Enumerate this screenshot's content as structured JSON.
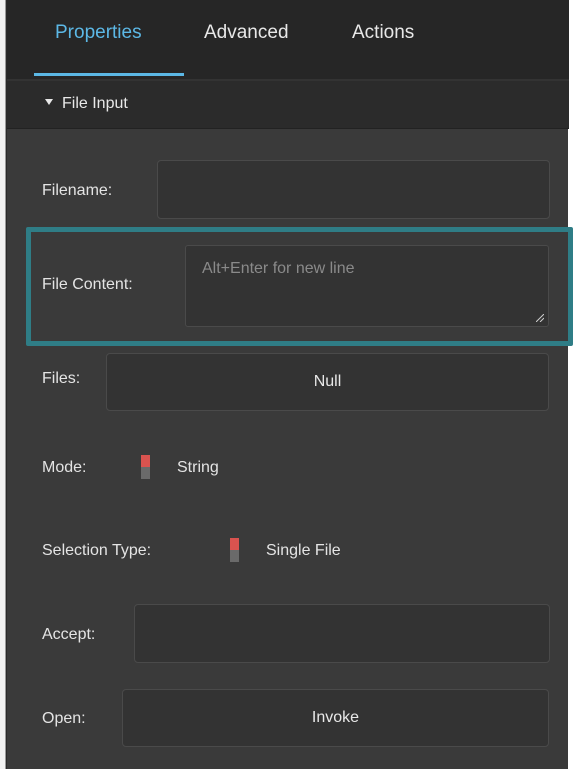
{
  "tabs": [
    {
      "label": "Properties",
      "active": true
    },
    {
      "label": "Advanced",
      "active": false
    },
    {
      "label": "Actions",
      "active": false
    }
  ],
  "section": {
    "title": "File Input",
    "expanded": true
  },
  "fields": {
    "filename": {
      "label": "Filename:",
      "value": ""
    },
    "file_content": {
      "label": "File Content:",
      "placeholder": "Alt+Enter for new line",
      "value": ""
    },
    "files": {
      "label": "Files:",
      "button_label": "Null"
    },
    "mode": {
      "label": "Mode:",
      "value": "String"
    },
    "selection_type": {
      "label": "Selection Type:",
      "value": "Single File"
    },
    "accept": {
      "label": "Accept:",
      "value": ""
    },
    "open": {
      "label": "Open:",
      "button_label": "Invoke"
    }
  },
  "colors": {
    "accent": "#5cb8e6",
    "highlight": "#2f7d86",
    "toggle_on": "#d9534f",
    "panel_bg": "#3a3a3a"
  },
  "icons": {
    "section_toggle": "caret-down-icon",
    "textarea_resize": "resize-grip-icon"
  }
}
